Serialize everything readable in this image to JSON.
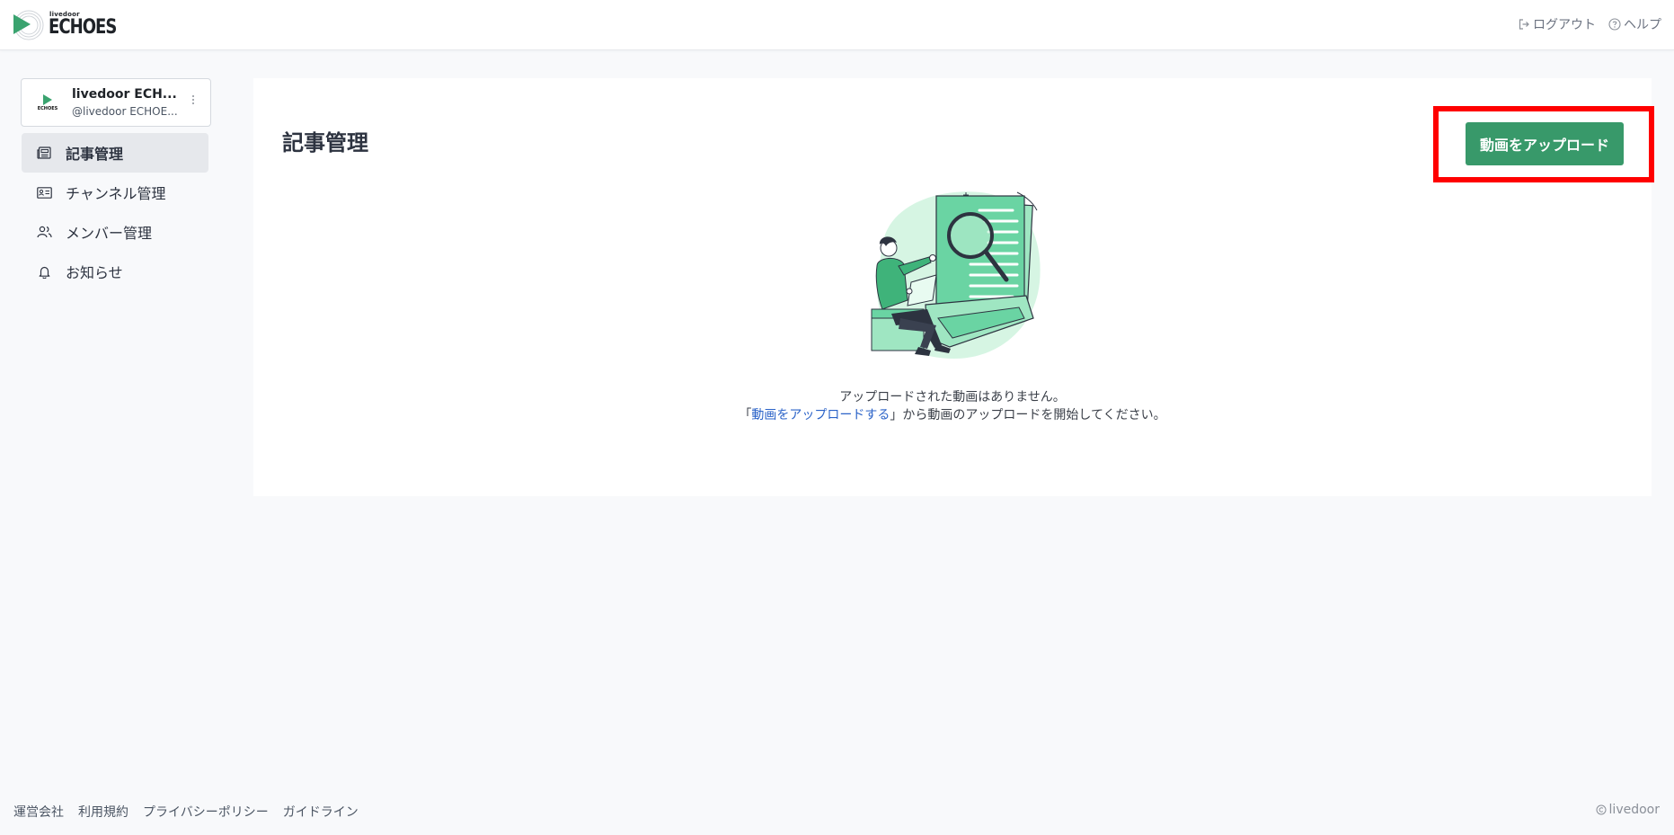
{
  "header": {
    "logo_small": "livedoor",
    "logo_big": "ECHOES",
    "logout_label": "ログアウト",
    "help_label": "ヘルプ"
  },
  "account": {
    "avatar_text": "ECHOES",
    "name": "livedoor ECH...",
    "handle": "@livedoor ECHOE..."
  },
  "sidebar": {
    "items": [
      {
        "label": "記事管理",
        "icon": "newspaper-icon",
        "active": true
      },
      {
        "label": "チャンネル管理",
        "icon": "id-card-icon",
        "active": false
      },
      {
        "label": "メンバー管理",
        "icon": "users-icon",
        "active": false
      },
      {
        "label": "お知らせ",
        "icon": "bell-icon",
        "active": false
      }
    ]
  },
  "main": {
    "title": "記事管理",
    "upload_button": "動画をアップロード",
    "empty_line1": "アップロードされた動画はありません。",
    "empty_quote_open": "「",
    "empty_link": "動画をアップロードする",
    "empty_quote_close_rest": "」から動画のアップロードを開始してください。"
  },
  "footer": {
    "links": [
      "運営会社",
      "利用規約",
      "プライバシーポリシー",
      "ガイドライン"
    ],
    "copyright": "livedoor"
  },
  "colors": {
    "accent_green": "#38996a",
    "highlight_red": "#ff0000",
    "link_blue": "#2b63c8"
  }
}
